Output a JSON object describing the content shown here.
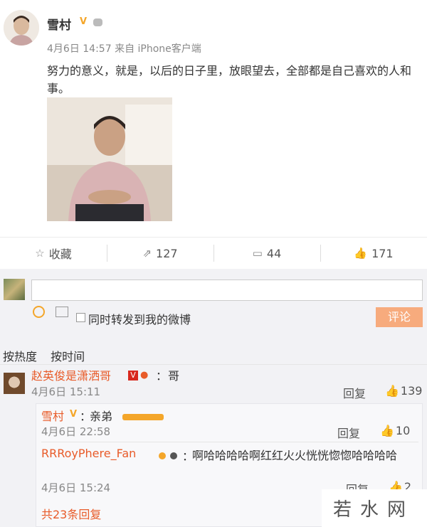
{
  "post": {
    "author": "雪村",
    "date": "4月6日 14:57",
    "source_prefix": "来自",
    "source": "iPhone客户端",
    "text": "努力的意义，就是，以后的日子里，放眼望去，全部都是自己喜欢的人和事。"
  },
  "actions": {
    "favorite": "收藏",
    "forward": "127",
    "comment": "44",
    "like": "171"
  },
  "compose": {
    "forward_label": "同时转发到我的微博",
    "submit": "评论"
  },
  "sort": {
    "hot": "按热度",
    "time": "按时间"
  },
  "comments": [
    {
      "name": "赵英俊是潇洒哥",
      "badge": "V",
      "sep": "：",
      "text": "哥",
      "time": "4月6日 15:11",
      "reply": "回复",
      "likes": "139"
    }
  ],
  "replies": [
    {
      "name": "雪村",
      "sep": "：",
      "text": "亲弟",
      "time": "4月6日 22:58",
      "reply": "回复",
      "likes": "10"
    },
    {
      "name": "RRRoyPhere_Fan",
      "sep": "：",
      "text": "啊哈哈哈哈啊红红火火恍恍惚惚哈哈哈哈",
      "time": "4月6日 15:24",
      "reply": "回复",
      "likes": "2"
    }
  ],
  "total_replies": "共23条回复",
  "watermark": "若水网",
  "colors": {
    "link_orange": "#e85b29",
    "submit_bg": "#f7ab7d",
    "verified_gold": "#f4a62a"
  }
}
